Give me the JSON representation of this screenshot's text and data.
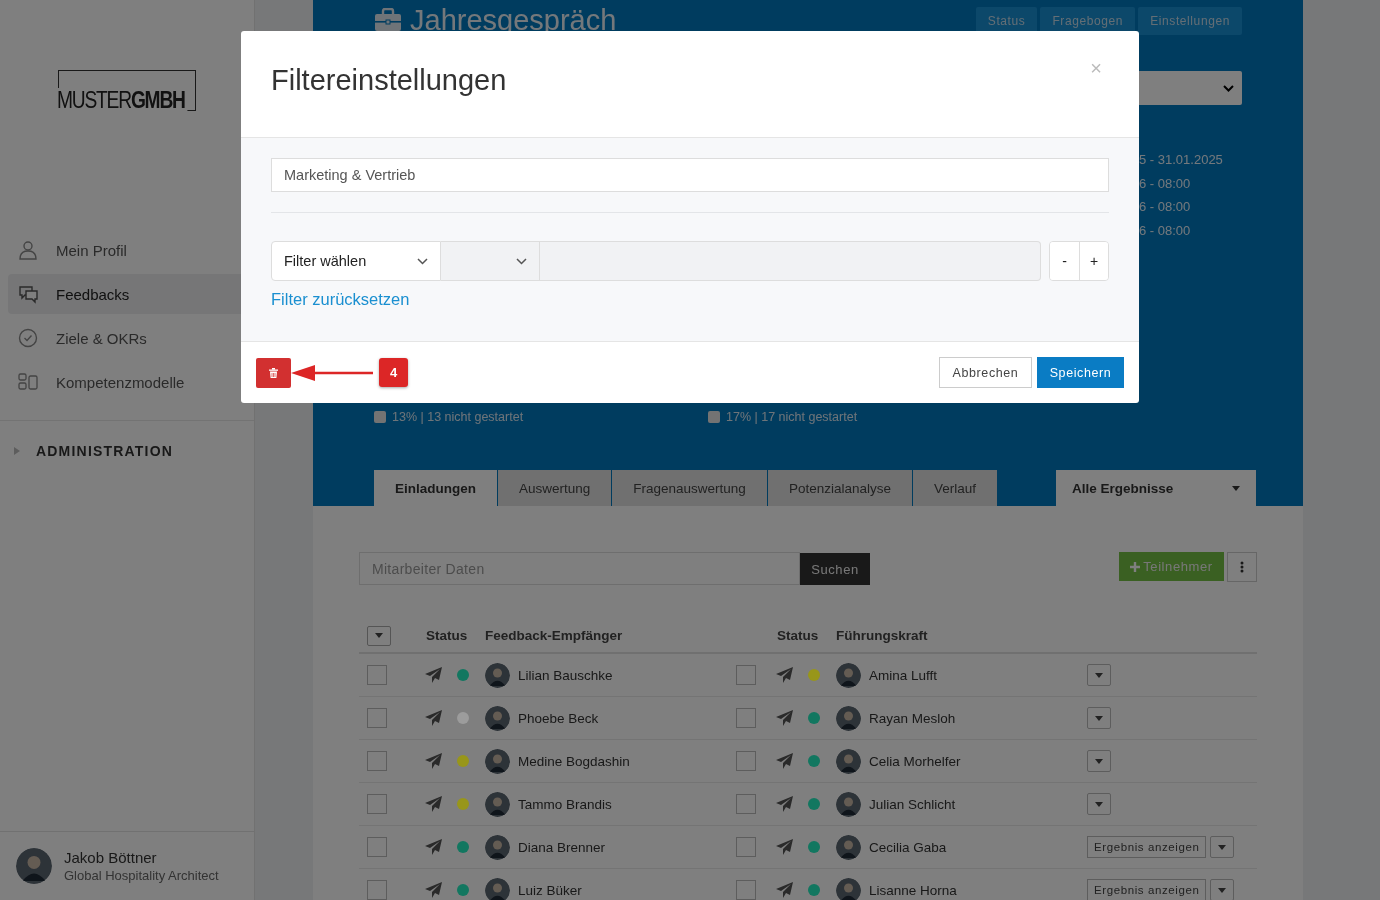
{
  "sidebar": {
    "logo": {
      "light": "MUSTER",
      "bold": "GMBH"
    },
    "nav": [
      {
        "label": "Mein Profil",
        "kind": "profile",
        "selected": false
      },
      {
        "label": "Feedbacks",
        "kind": "feedback",
        "selected": true
      },
      {
        "label": "Ziele & OKRs",
        "kind": "goals",
        "selected": false
      },
      {
        "label": "Kompetenzmodelle",
        "kind": "models",
        "selected": false
      }
    ],
    "section": "ADMINISTRATION",
    "user": {
      "name": "Jakob Böttner",
      "role": "Global Hospitality Architect"
    }
  },
  "header": {
    "title": "Jahresgespräch",
    "tabs": [
      "Status",
      "Fragebogen",
      "Einstellungen"
    ],
    "dates": [
      "5 - 31.01.2025",
      "6 - 08:00",
      "6 - 08:00",
      "6 - 08:00"
    ]
  },
  "legend": [
    {
      "text": "13% | 13 nicht gestartet",
      "color": "#737373"
    },
    {
      "text": "17% | 17 nicht gestartet",
      "color": "#737373"
    }
  ],
  "tabs": [
    {
      "label": "Einladungen",
      "selected": true
    },
    {
      "label": "Auswertung",
      "selected": false
    },
    {
      "label": "Fragenauswertung",
      "selected": false
    },
    {
      "label": "Potenzialanalyse",
      "selected": false
    },
    {
      "label": "Verlauf",
      "selected": false
    }
  ],
  "result_filter": "Alle Ergebnisse",
  "search": {
    "placeholder": "Mitarbeiter Daten",
    "button": "Suchen"
  },
  "add_button": "Teilnehmer",
  "table": {
    "columns": [
      "Status",
      "Feedback-Empfänger",
      "Status",
      "Führungskraft"
    ],
    "rows": [
      {
        "recipient": {
          "name": "Lilian Bauschke",
          "checked": false,
          "color": "#127760"
        },
        "manager": {
          "name": "Amina Lufft",
          "checked": false,
          "color": "#98961a"
        },
        "action": {
          "kind": "menu"
        }
      },
      {
        "recipient": {
          "name": "Phoebe Beck",
          "checked": false,
          "color": "#9c9c9c"
        },
        "manager": {
          "name": "Rayan Mesloh",
          "checked": false,
          "color": "#127760"
        },
        "action": {
          "kind": "menu"
        }
      },
      {
        "recipient": {
          "name": "Medine Bogdashin",
          "checked": false,
          "color": "#98961a"
        },
        "manager": {
          "name": "Celia Morhelfer",
          "checked": false,
          "color": "#127760"
        },
        "action": {
          "kind": "menu"
        }
      },
      {
        "recipient": {
          "name": "Tammo Brandis",
          "checked": false,
          "color": "#98961a"
        },
        "manager": {
          "name": "Julian Schlicht",
          "checked": false,
          "color": "#127760"
        },
        "action": {
          "kind": "menu"
        }
      },
      {
        "recipient": {
          "name": "Diana Brenner",
          "checked": false,
          "color": "#127760"
        },
        "manager": {
          "name": "Cecilia Gaba",
          "checked": false,
          "color": "#127760"
        },
        "action": {
          "kind": "result",
          "label": "Ergebnis anzeigen"
        }
      },
      {
        "recipient": {
          "name": "Luiz Büker",
          "checked": false,
          "color": "#127760"
        },
        "manager": {
          "name": "Lisanne Horna",
          "checked": false,
          "color": "#127760"
        },
        "action": {
          "kind": "result",
          "label": "Ergebnis anzeigen"
        }
      }
    ]
  },
  "dialog": {
    "title": "Filtereinstellungen",
    "close": "×",
    "department": "Marketing & Vertrieb",
    "filter_select": "Filter wählen",
    "operator_select": {
      "disabled": true
    },
    "value_field": {
      "disabled": true
    },
    "minus": "-",
    "plus": "+",
    "reset_link": "Filter zurücksetzen",
    "cancel": "Abbrechen",
    "save": "Speichern"
  },
  "callout": {
    "number": "4"
  }
}
